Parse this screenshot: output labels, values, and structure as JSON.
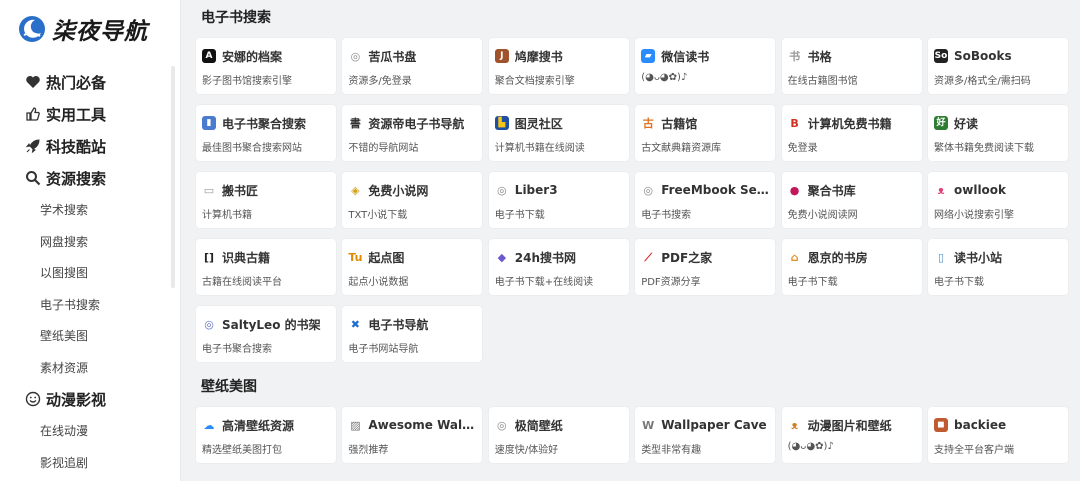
{
  "brand": {
    "name": "柒夜导航"
  },
  "sidebar": {
    "categories": [
      {
        "label": "热门必备",
        "icon": "heart-icon"
      },
      {
        "label": "实用工具",
        "icon": "thumbs-up-icon"
      },
      {
        "label": "科技酷站",
        "icon": "rocket-icon"
      },
      {
        "label": "资源搜索",
        "icon": "search-icon",
        "subs": [
          "学术搜索",
          "网盘搜索",
          "以图搜图",
          "电子书搜索",
          "壁纸美图",
          "素材资源"
        ]
      },
      {
        "label": "动漫影视",
        "icon": "smile-icon",
        "subs": [
          "在线动漫",
          "影视追剧"
        ]
      }
    ]
  },
  "sections": [
    {
      "title": "电子书搜索",
      "cards": [
        {
          "title": "安娜的档案",
          "desc": "影子图书馆搜索引擎",
          "icon": "anna-archive-icon",
          "glyph": "A",
          "color": "#111111",
          "fg": "#ffffff"
        },
        {
          "title": "苦瓜书盘",
          "desc": "资源多/免登录",
          "icon": "globe-icon",
          "glyph": "◎",
          "color": "#ffffff",
          "fg": "#888888"
        },
        {
          "title": "鸠摩搜书",
          "desc": "聚合文档搜索引擎",
          "icon": "jiumo-icon",
          "glyph": "J",
          "color": "#a0522d",
          "fg": "#ffffff"
        },
        {
          "title": "微信读书",
          "desc": "(◕ᴗ◕✿)♪",
          "icon": "wechat-read-icon",
          "glyph": "▰",
          "color": "#2a8cff",
          "fg": "#ffffff"
        },
        {
          "title": "书格",
          "desc": "在线古籍图书馆",
          "icon": "shuge-icon",
          "glyph": "书",
          "color": "#ffffff",
          "fg": "#999999"
        },
        {
          "title": "SoBooks",
          "desc": "资源多/格式全/需扫码",
          "icon": "sobooks-icon",
          "glyph": "So",
          "color": "#222222",
          "fg": "#ffffff"
        },
        {
          "title": "电子书聚合搜索",
          "desc": "最佳图书聚合搜索网站",
          "icon": "book-icon",
          "glyph": "▮",
          "color": "#4a7bd0",
          "fg": "#ffffff"
        },
        {
          "title": "资源帝电子书导航",
          "desc": "不错的导航网站",
          "icon": "books-icon",
          "glyph": "書",
          "color": "#ffffff",
          "fg": "#333333"
        },
        {
          "title": "图灵社区",
          "desc": "计算机书籍在线阅读",
          "icon": "turing-icon",
          "glyph": "▙",
          "color": "#1e4fa0",
          "fg": "#f5c518"
        },
        {
          "title": "古籍馆",
          "desc": "古文献典籍资源库",
          "icon": "guji-icon",
          "glyph": "古",
          "color": "#ffffff",
          "fg": "#e07020"
        },
        {
          "title": "计算机免费书籍",
          "desc": "免登录",
          "icon": "computer-books-icon",
          "glyph": "B",
          "color": "#ffffff",
          "fg": "#d03020"
        },
        {
          "title": "好读",
          "desc": "繁体书籍免费阅读下载",
          "icon": "haodoo-icon",
          "glyph": "好",
          "color": "#2e7d32",
          "fg": "#ffffff"
        },
        {
          "title": "搬书匠",
          "desc": "计算机书籍",
          "icon": "banshujiang-icon",
          "glyph": "▭",
          "color": "#ffffff",
          "fg": "#999999"
        },
        {
          "title": "免费小说网",
          "desc": "TXT小说下载",
          "icon": "novel-icon",
          "glyph": "◈",
          "color": "#ffffff",
          "fg": "#d4a017"
        },
        {
          "title": "Liber3",
          "desc": "电子书下载",
          "icon": "globe-icon",
          "glyph": "◎",
          "color": "#ffffff",
          "fg": "#888888"
        },
        {
          "title": "FreeMbook Search",
          "desc": "电子书搜索",
          "icon": "globe-icon",
          "glyph": "◎",
          "color": "#ffffff",
          "fg": "#888888"
        },
        {
          "title": "聚合书库",
          "desc": "免费小说阅读网",
          "icon": "juhe-icon",
          "glyph": "●",
          "color": "#ffffff",
          "fg": "#c2185b"
        },
        {
          "title": "owllook",
          "desc": "网络小说搜索引擎",
          "icon": "owl-icon",
          "glyph": "ᴥ",
          "color": "#ffffff",
          "fg": "#e0407a"
        },
        {
          "title": "识典古籍",
          "desc": "古籍在线阅读平台",
          "icon": "shidian-icon",
          "glyph": "[]",
          "color": "#ffffff",
          "fg": "#222222"
        },
        {
          "title": "起点图",
          "desc": "起点小说数据",
          "icon": "qidian-icon",
          "glyph": "Tu",
          "color": "#ffffff",
          "fg": "#e08a00"
        },
        {
          "title": "24h搜书网",
          "desc": "电子书下载+在线阅读",
          "icon": "24h-icon",
          "glyph": "◆",
          "color": "#ffffff",
          "fg": "#6a5acd"
        },
        {
          "title": "PDF之家",
          "desc": "PDF资源分享",
          "icon": "pdf-icon",
          "glyph": "⟋",
          "color": "#ffffff",
          "fg": "#e02020"
        },
        {
          "title": "恩京的书房",
          "desc": "电子书下载",
          "icon": "house-icon",
          "glyph": "⌂",
          "color": "#ffffff",
          "fg": "#e09020"
        },
        {
          "title": "读书小站",
          "desc": "电子书下载",
          "icon": "dushu-icon",
          "glyph": "▯",
          "color": "#ffffff",
          "fg": "#4a90d0"
        },
        {
          "title": "SaltyLeo 的书架",
          "desc": "电子书聚合搜索",
          "icon": "saltyleo-icon",
          "glyph": "◎",
          "color": "#ffffff",
          "fg": "#6070c0"
        },
        {
          "title": "电子书导航",
          "desc": "电子书网站导航",
          "icon": "cross-icon",
          "glyph": "✖",
          "color": "#ffffff",
          "fg": "#1e6fd0"
        }
      ]
    },
    {
      "title": "壁纸美图",
      "cards": [
        {
          "title": "高清壁纸资源",
          "desc": "精选壁纸美图打包",
          "icon": "cloud-icon",
          "glyph": "☁",
          "color": "#ffffff",
          "fg": "#2a8cff"
        },
        {
          "title": "Awesome Wallpa...",
          "desc": "强烈推荐",
          "icon": "image-icon",
          "glyph": "▨",
          "color": "#ffffff",
          "fg": "#777777"
        },
        {
          "title": "极简壁纸",
          "desc": "速度快/体验好",
          "icon": "globe-icon",
          "glyph": "◎",
          "color": "#ffffff",
          "fg": "#888888"
        },
        {
          "title": "Wallpaper Cave",
          "desc": "类型非常有趣",
          "icon": "wallpaper-cave-icon",
          "glyph": "W",
          "color": "#ffffff",
          "fg": "#777777"
        },
        {
          "title": "动漫图片和壁纸",
          "desc": "(◕ᴗ◕✿)♪",
          "icon": "anime-icon",
          "glyph": "ᴥ",
          "color": "#ffffff",
          "fg": "#d08020"
        },
        {
          "title": "backiee",
          "desc": "支持全平台客户端",
          "icon": "backiee-icon",
          "glyph": "◼",
          "color": "#c05a30",
          "fg": "#ffffff"
        }
      ]
    }
  ]
}
